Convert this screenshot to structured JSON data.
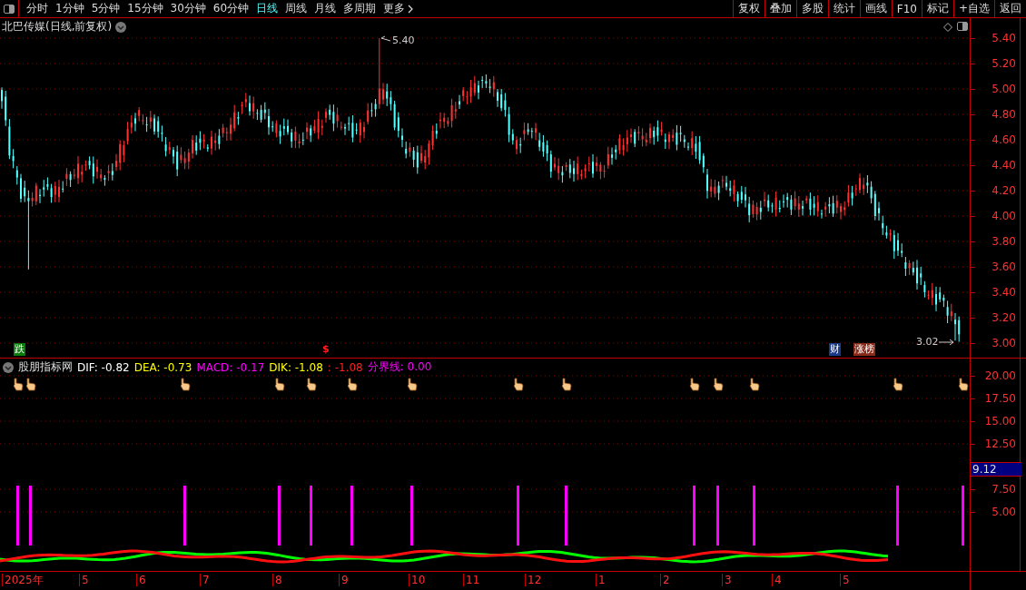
{
  "toolbar": {
    "periods": [
      {
        "label": "分时",
        "selected": false
      },
      {
        "label": "1分钟",
        "selected": false
      },
      {
        "label": "5分钟",
        "selected": false
      },
      {
        "label": "15分钟",
        "selected": false
      },
      {
        "label": "30分钟",
        "selected": false
      },
      {
        "label": "60分钟",
        "selected": false
      },
      {
        "label": "日线",
        "selected": true
      },
      {
        "label": "周线",
        "selected": false
      },
      {
        "label": "月线",
        "selected": false
      },
      {
        "label": "多周期",
        "selected": false
      }
    ],
    "more": "更多",
    "buttons": [
      "复权",
      "叠加",
      "多股",
      "统计",
      "画线",
      "F10",
      "标记",
      "+自选",
      "返回"
    ]
  },
  "chart": {
    "title": "北巴传媒(日线,前复权)",
    "price_axis": [
      "5.40",
      "5.20",
      "5.00",
      "4.80",
      "4.60",
      "4.40",
      "4.20",
      "4.00",
      "3.80",
      "3.60",
      "3.40",
      "3.20",
      "3.00"
    ],
    "high_label": "5.40",
    "low_label": "3.02",
    "markers": [
      {
        "kind": "fall",
        "label": "跌"
      },
      {
        "kind": "dollar",
        "label": "$"
      },
      {
        "kind": "finance",
        "label": "财"
      },
      {
        "kind": "rank",
        "label": "涨榜"
      }
    ]
  },
  "indicator": {
    "name": "股朋指标网",
    "values": [
      {
        "label": "DIF: -0.82",
        "color": "#ffffff"
      },
      {
        "label": "DEA: -0.73",
        "color": "#ffff00"
      },
      {
        "label": "MACD: -0.17",
        "color": "#ff00ff"
      },
      {
        "label": "DIK: -1.08",
        "color": "#ffff00"
      },
      {
        "label": ": -1.08",
        "color": "#ff2020"
      },
      {
        "label": "分界线: 0.00",
        "color": "#ff00ff"
      }
    ],
    "axis": [
      "20.00",
      "17.50",
      "15.00",
      "12.50",
      "7.50",
      "5.00"
    ],
    "cursor_value": "9.12"
  },
  "time_axis": [
    "2025年",
    "5",
    "6",
    "7",
    "8",
    "9",
    "10",
    "11",
    "12",
    "1",
    "2",
    "3",
    "4",
    "5"
  ]
}
